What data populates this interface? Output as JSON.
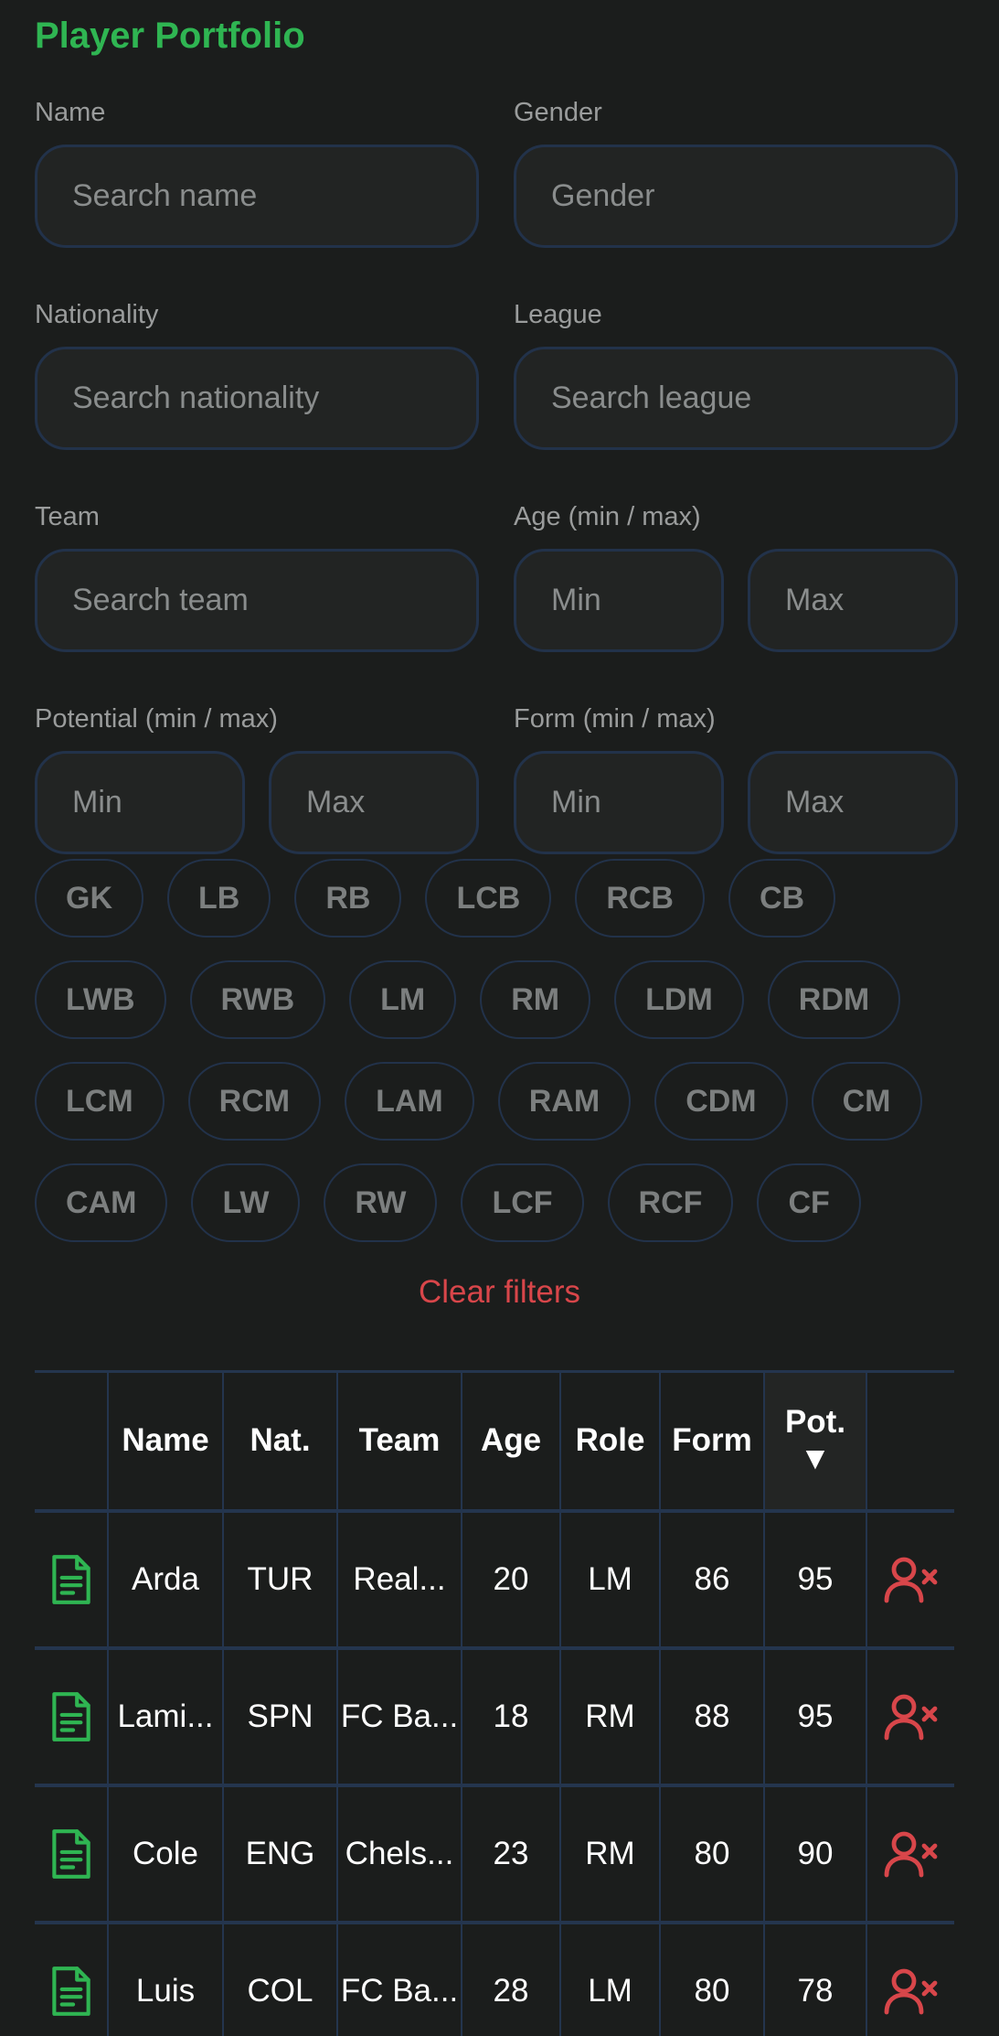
{
  "page_title": "Player Portfolio",
  "filters": {
    "name": {
      "label": "Name",
      "placeholder": "Search name"
    },
    "gender": {
      "label": "Gender",
      "placeholder": "Gender"
    },
    "nationality": {
      "label": "Nationality",
      "placeholder": "Search nationality"
    },
    "league": {
      "label": "League",
      "placeholder": "Search league"
    },
    "team": {
      "label": "Team",
      "placeholder": "Search team"
    },
    "age": {
      "label": "Age (min / max)",
      "min_placeholder": "Min",
      "max_placeholder": "Max"
    },
    "potential": {
      "label": "Potential (min / max)",
      "min_placeholder": "Min",
      "max_placeholder": "Max"
    },
    "form": {
      "label": "Form (min / max)",
      "min_placeholder": "Min",
      "max_placeholder": "Max"
    }
  },
  "positions": [
    [
      "GK",
      "LB",
      "RB",
      "LCB",
      "RCB",
      "CB"
    ],
    [
      "LWB",
      "RWB",
      "LM",
      "RM",
      "LDM",
      "RDM"
    ],
    [
      "LCM",
      "RCM",
      "LAM",
      "RAM",
      "CDM",
      "CM"
    ],
    [
      "CAM",
      "LW",
      "RW",
      "LCF",
      "RCF",
      "CF"
    ]
  ],
  "clear_filters_label": "Clear filters",
  "table": {
    "columns": [
      "",
      "Name",
      "Nat.",
      "Team",
      "Age",
      "Role",
      "Form",
      "Pot. ▼",
      ""
    ],
    "rows": [
      {
        "name": "Arda",
        "nat": "TUR",
        "team": "Real...",
        "age": "20",
        "role": "LM",
        "form": "86",
        "pot": "95"
      },
      {
        "name": "Lami...",
        "nat": "SPN",
        "team": "FC Ba...",
        "age": "18",
        "role": "RM",
        "form": "88",
        "pot": "95"
      },
      {
        "name": "Cole",
        "nat": "ENG",
        "team": "Chels...",
        "age": "23",
        "role": "RM",
        "form": "80",
        "pot": "90"
      },
      {
        "name": "Luis",
        "nat": "COL",
        "team": "FC Ba...",
        "age": "28",
        "role": "LM",
        "form": "80",
        "pot": "78"
      }
    ]
  },
  "colors": {
    "accent": "#2fb552",
    "danger": "#d8464a",
    "background": "#1b1d1c",
    "border": "#24354e"
  },
  "icons": {
    "report": "document-icon",
    "remove": "remove-user-icon"
  }
}
